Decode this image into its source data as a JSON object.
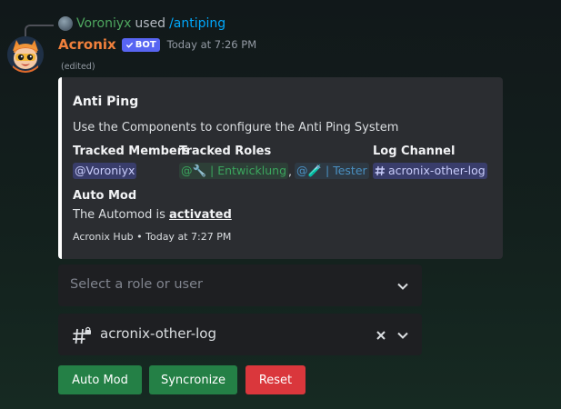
{
  "reply": {
    "user": "Voroniyx",
    "action": "used",
    "command": "/antiping"
  },
  "message": {
    "author": "Acronix",
    "bot_badge": "BOT",
    "timestamp": "Today at 7:26 PM",
    "edited": "(edited)"
  },
  "embed": {
    "border_color": "#ffffff",
    "title": "Anti Ping",
    "description": "Use the Components to configure the Anti Ping System",
    "fields": {
      "tracked_members": {
        "name": "Tracked Members",
        "value": "@Voroniyx"
      },
      "tracked_roles": {
        "name": "Tracked Roles",
        "roles": [
          {
            "text": "@🔧 | Entwicklung",
            "color": "#3ba55d"
          },
          {
            "text": "@🧪 | Tester",
            "color": "#4a90c2"
          }
        ],
        "separator": ","
      },
      "log_channel": {
        "name": "Log Channel",
        "value": "acronix-other-log",
        "icon": "channel-hash-icon"
      }
    },
    "automod": {
      "name": "Auto Mod",
      "prefix": "The Automod is ",
      "status": "activated"
    },
    "footer": "Acronix Hub • Today at 7:27 PM"
  },
  "selects": {
    "role_user": {
      "placeholder": "Select a role or user"
    },
    "channel": {
      "value": "acronix-other-log",
      "icon": "locked-channel-hash-icon"
    }
  },
  "buttons": {
    "automod": "Auto Mod",
    "sync": "Syncronize",
    "reset": "Reset"
  },
  "colors": {
    "success": "#248046",
    "danger": "#da373c",
    "blurple": "#5865f2",
    "username": "#f0803c"
  }
}
